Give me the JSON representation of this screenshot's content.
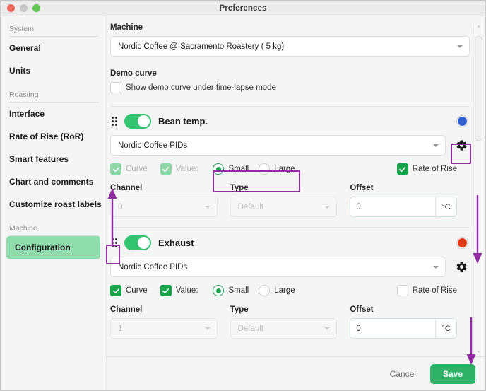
{
  "window": {
    "title": "Preferences",
    "controls": [
      "close",
      "minimize",
      "zoom"
    ]
  },
  "sidebar": {
    "groups": [
      {
        "label": "System",
        "items": [
          {
            "label": "General",
            "active": false
          },
          {
            "label": "Units",
            "active": false
          }
        ]
      },
      {
        "label": "Roasting",
        "items": [
          {
            "label": "Interface",
            "active": false
          },
          {
            "label": "Rate of Rise (RoR)",
            "active": false
          },
          {
            "label": "Smart features",
            "active": false
          },
          {
            "label": "Chart and comments",
            "active": false
          },
          {
            "label": "Customize roast labels",
            "active": false
          }
        ]
      },
      {
        "label": "Machine",
        "items": [
          {
            "label": "Configuration",
            "active": true
          }
        ]
      }
    ]
  },
  "main": {
    "machine": {
      "label": "Machine",
      "value": "Nordic Coffee @ Sacramento Roastery ( 5 kg)"
    },
    "demo_curve": {
      "label": "Demo curve",
      "checkbox_label": "Show demo curve under time-lapse mode",
      "checked": false
    },
    "devices": [
      {
        "name": "Bean temp.",
        "enabled": true,
        "color": "#2f5fd0",
        "source": "Nordic Coffee PIDs",
        "curve": {
          "label": "Curve",
          "checked": true,
          "disabled": true
        },
        "value": {
          "label": "Value:",
          "checked": true,
          "disabled": true
        },
        "size": {
          "selected": "Small",
          "options": [
            "Small",
            "Large"
          ]
        },
        "rate_of_rise": {
          "label": "Rate of Rise",
          "checked": true
        },
        "channel": {
          "label": "Channel",
          "value": "0",
          "disabled": true
        },
        "type": {
          "label": "Type",
          "value": "Default",
          "disabled": true
        },
        "offset": {
          "label": "Offset",
          "value": "0",
          "unit": "°C"
        }
      },
      {
        "name": "Exhaust",
        "enabled": true,
        "color": "#e03a13",
        "source": "Nordic Coffee PIDs",
        "curve": {
          "label": "Curve",
          "checked": true,
          "disabled": false
        },
        "value": {
          "label": "Value:",
          "checked": true,
          "disabled": false
        },
        "size": {
          "selected": "Small",
          "options": [
            "Small",
            "Large"
          ]
        },
        "rate_of_rise": {
          "label": "Rate of Rise",
          "checked": false
        },
        "channel": {
          "label": "Channel",
          "value": "1",
          "disabled": true
        },
        "type": {
          "label": "Type",
          "value": "Default",
          "disabled": true
        },
        "offset": {
          "label": "Offset",
          "value": "0",
          "unit": "°C"
        }
      }
    ]
  },
  "footer": {
    "cancel_label": "Cancel",
    "save_label": "Save"
  },
  "scrollbar": {
    "up_arrow": "⌃",
    "down_arrow": "⌄"
  },
  "annotations": {
    "color": "#8e2ca0",
    "items": [
      {
        "kind": "box",
        "target": "settings-gear-bean-temp"
      },
      {
        "kind": "box",
        "target": "size-radio-group-bean-temp"
      },
      {
        "kind": "box",
        "target": "drag-handle-exhaust"
      },
      {
        "kind": "arrow",
        "direction": "up",
        "target": "drag-handle-exhaust-to-bean-temp"
      },
      {
        "kind": "arrow",
        "direction": "down",
        "target": "scrollbar-scroll-down"
      },
      {
        "kind": "arrow",
        "direction": "down",
        "target": "save-button"
      }
    ]
  }
}
